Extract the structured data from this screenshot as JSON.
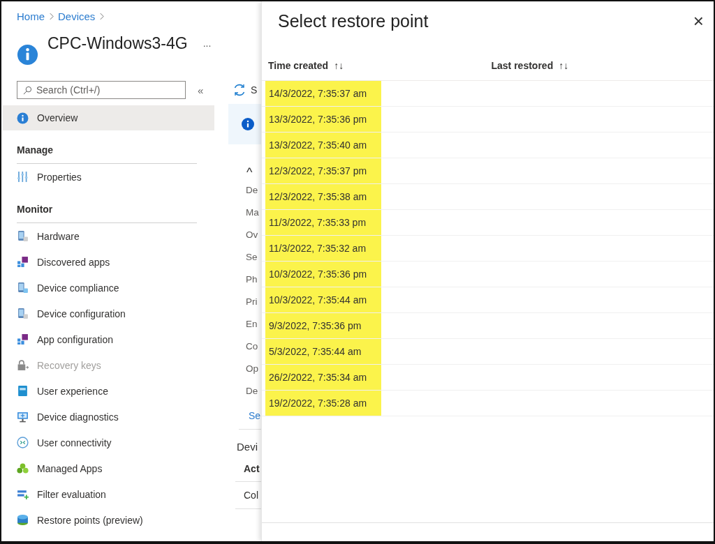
{
  "breadcrumb": [
    {
      "label": "Home"
    },
    {
      "label": "Devices"
    }
  ],
  "device": {
    "title": "CPC-Windows3-4G",
    "more": "..."
  },
  "search": {
    "placeholder": "Search (Ctrl+/)",
    "collapse": "«"
  },
  "nav": [
    {
      "kind": "item",
      "label": "Overview",
      "selected": true,
      "disabled": false
    },
    {
      "kind": "section",
      "label": "Manage"
    },
    {
      "kind": "item",
      "label": "Properties",
      "selected": false,
      "disabled": false
    },
    {
      "kind": "section",
      "label": "Monitor"
    },
    {
      "kind": "item",
      "label": "Hardware",
      "selected": false,
      "disabled": false
    },
    {
      "kind": "item",
      "label": "Discovered apps",
      "selected": false,
      "disabled": false
    },
    {
      "kind": "item",
      "label": "Device compliance",
      "selected": false,
      "disabled": false
    },
    {
      "kind": "item",
      "label": "Device configuration",
      "selected": false,
      "disabled": false
    },
    {
      "kind": "item",
      "label": "App configuration",
      "selected": false,
      "disabled": false
    },
    {
      "kind": "item",
      "label": "Recovery keys",
      "selected": false,
      "disabled": true
    },
    {
      "kind": "item",
      "label": "User experience",
      "selected": false,
      "disabled": false
    },
    {
      "kind": "item",
      "label": "Device diagnostics",
      "selected": false,
      "disabled": false
    },
    {
      "kind": "item",
      "label": "User connectivity",
      "selected": false,
      "disabled": false
    },
    {
      "kind": "item",
      "label": "Managed Apps",
      "selected": false,
      "disabled": false
    },
    {
      "kind": "item",
      "label": "Filter evaluation",
      "selected": false,
      "disabled": false
    },
    {
      "kind": "item",
      "label": "Restore points (preview)",
      "selected": false,
      "disabled": false
    }
  ],
  "main": {
    "toolbar_text": "S",
    "collapse_glyph": "^",
    "fields": [
      "De",
      "Ma",
      "Ov",
      "Se",
      "Ph",
      "Pri",
      "En",
      "Co",
      "Op",
      "De"
    ],
    "link": "Se",
    "heading": "Devi",
    "column": "Act",
    "cell": "Col"
  },
  "panel": {
    "title": "Select restore point",
    "close": "×",
    "columns": [
      {
        "label": "Time created",
        "sort": "↑↓"
      },
      {
        "label": "Last restored",
        "sort": "↑↓"
      }
    ],
    "rows": [
      {
        "time_created": "14/3/2022, 7:35:37 am",
        "highlighted": true
      },
      {
        "time_created": "13/3/2022, 7:35:36 pm",
        "highlighted": true
      },
      {
        "time_created": "13/3/2022, 7:35:40 am",
        "highlighted": true
      },
      {
        "time_created": "12/3/2022, 7:35:37 pm",
        "highlighted": true
      },
      {
        "time_created": "12/3/2022, 7:35:38 am",
        "highlighted": true
      },
      {
        "time_created": "11/3/2022, 7:35:33 pm",
        "highlighted": true
      },
      {
        "time_created": "11/3/2022, 7:35:32 am",
        "highlighted": true
      },
      {
        "time_created": "10/3/2022, 7:35:36 pm",
        "highlighted": true
      },
      {
        "time_created": "10/3/2022, 7:35:44 am",
        "highlighted": true
      },
      {
        "time_created": "9/3/2022, 7:35:36 pm",
        "highlighted": true
      },
      {
        "time_created": "5/3/2022, 7:35:44 am",
        "highlighted": true
      },
      {
        "time_created": "26/2/2022, 7:35:34 am",
        "highlighted": true
      },
      {
        "time_created": "19/2/2022, 7:35:28 am",
        "highlighted": true
      }
    ]
  }
}
